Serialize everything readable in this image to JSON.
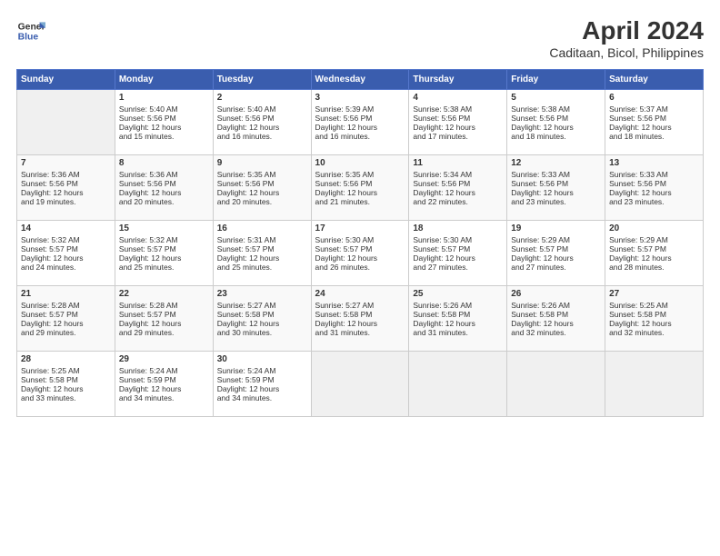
{
  "header": {
    "logo_line1": "General",
    "logo_line2": "Blue",
    "title": "April 2024",
    "subtitle": "Caditaan, Bicol, Philippines"
  },
  "calendar": {
    "days_of_week": [
      "Sunday",
      "Monday",
      "Tuesday",
      "Wednesday",
      "Thursday",
      "Friday",
      "Saturday"
    ],
    "weeks": [
      [
        {
          "day": "",
          "info": ""
        },
        {
          "day": "1",
          "info": "Sunrise: 5:40 AM\nSunset: 5:56 PM\nDaylight: 12 hours\nand 15 minutes."
        },
        {
          "day": "2",
          "info": "Sunrise: 5:40 AM\nSunset: 5:56 PM\nDaylight: 12 hours\nand 16 minutes."
        },
        {
          "day": "3",
          "info": "Sunrise: 5:39 AM\nSunset: 5:56 PM\nDaylight: 12 hours\nand 16 minutes."
        },
        {
          "day": "4",
          "info": "Sunrise: 5:38 AM\nSunset: 5:56 PM\nDaylight: 12 hours\nand 17 minutes."
        },
        {
          "day": "5",
          "info": "Sunrise: 5:38 AM\nSunset: 5:56 PM\nDaylight: 12 hours\nand 18 minutes."
        },
        {
          "day": "6",
          "info": "Sunrise: 5:37 AM\nSunset: 5:56 PM\nDaylight: 12 hours\nand 18 minutes."
        }
      ],
      [
        {
          "day": "7",
          "info": "Sunrise: 5:36 AM\nSunset: 5:56 PM\nDaylight: 12 hours\nand 19 minutes."
        },
        {
          "day": "8",
          "info": "Sunrise: 5:36 AM\nSunset: 5:56 PM\nDaylight: 12 hours\nand 20 minutes."
        },
        {
          "day": "9",
          "info": "Sunrise: 5:35 AM\nSunset: 5:56 PM\nDaylight: 12 hours\nand 20 minutes."
        },
        {
          "day": "10",
          "info": "Sunrise: 5:35 AM\nSunset: 5:56 PM\nDaylight: 12 hours\nand 21 minutes."
        },
        {
          "day": "11",
          "info": "Sunrise: 5:34 AM\nSunset: 5:56 PM\nDaylight: 12 hours\nand 22 minutes."
        },
        {
          "day": "12",
          "info": "Sunrise: 5:33 AM\nSunset: 5:56 PM\nDaylight: 12 hours\nand 23 minutes."
        },
        {
          "day": "13",
          "info": "Sunrise: 5:33 AM\nSunset: 5:56 PM\nDaylight: 12 hours\nand 23 minutes."
        }
      ],
      [
        {
          "day": "14",
          "info": "Sunrise: 5:32 AM\nSunset: 5:57 PM\nDaylight: 12 hours\nand 24 minutes."
        },
        {
          "day": "15",
          "info": "Sunrise: 5:32 AM\nSunset: 5:57 PM\nDaylight: 12 hours\nand 25 minutes."
        },
        {
          "day": "16",
          "info": "Sunrise: 5:31 AM\nSunset: 5:57 PM\nDaylight: 12 hours\nand 25 minutes."
        },
        {
          "day": "17",
          "info": "Sunrise: 5:30 AM\nSunset: 5:57 PM\nDaylight: 12 hours\nand 26 minutes."
        },
        {
          "day": "18",
          "info": "Sunrise: 5:30 AM\nSunset: 5:57 PM\nDaylight: 12 hours\nand 27 minutes."
        },
        {
          "day": "19",
          "info": "Sunrise: 5:29 AM\nSunset: 5:57 PM\nDaylight: 12 hours\nand 27 minutes."
        },
        {
          "day": "20",
          "info": "Sunrise: 5:29 AM\nSunset: 5:57 PM\nDaylight: 12 hours\nand 28 minutes."
        }
      ],
      [
        {
          "day": "21",
          "info": "Sunrise: 5:28 AM\nSunset: 5:57 PM\nDaylight: 12 hours\nand 29 minutes."
        },
        {
          "day": "22",
          "info": "Sunrise: 5:28 AM\nSunset: 5:57 PM\nDaylight: 12 hours\nand 29 minutes."
        },
        {
          "day": "23",
          "info": "Sunrise: 5:27 AM\nSunset: 5:58 PM\nDaylight: 12 hours\nand 30 minutes."
        },
        {
          "day": "24",
          "info": "Sunrise: 5:27 AM\nSunset: 5:58 PM\nDaylight: 12 hours\nand 31 minutes."
        },
        {
          "day": "25",
          "info": "Sunrise: 5:26 AM\nSunset: 5:58 PM\nDaylight: 12 hours\nand 31 minutes."
        },
        {
          "day": "26",
          "info": "Sunrise: 5:26 AM\nSunset: 5:58 PM\nDaylight: 12 hours\nand 32 minutes."
        },
        {
          "day": "27",
          "info": "Sunrise: 5:25 AM\nSunset: 5:58 PM\nDaylight: 12 hours\nand 32 minutes."
        }
      ],
      [
        {
          "day": "28",
          "info": "Sunrise: 5:25 AM\nSunset: 5:58 PM\nDaylight: 12 hours\nand 33 minutes."
        },
        {
          "day": "29",
          "info": "Sunrise: 5:24 AM\nSunset: 5:59 PM\nDaylight: 12 hours\nand 34 minutes."
        },
        {
          "day": "30",
          "info": "Sunrise: 5:24 AM\nSunset: 5:59 PM\nDaylight: 12 hours\nand 34 minutes."
        },
        {
          "day": "",
          "info": ""
        },
        {
          "day": "",
          "info": ""
        },
        {
          "day": "",
          "info": ""
        },
        {
          "day": "",
          "info": ""
        }
      ]
    ]
  }
}
